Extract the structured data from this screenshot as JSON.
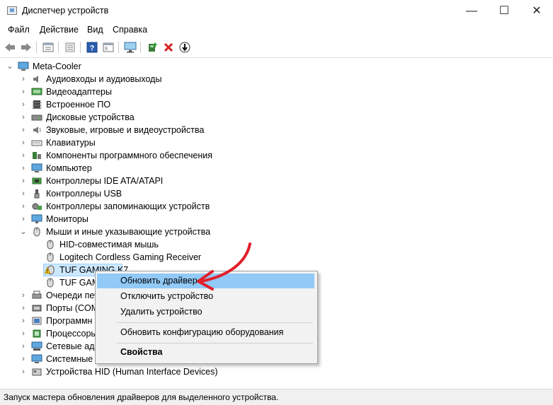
{
  "window": {
    "title": "Диспетчер устройств",
    "minimize": "—",
    "maximize": "☐",
    "close": "✕"
  },
  "menu": [
    "Файл",
    "Действие",
    "Вид",
    "Справка"
  ],
  "toolbar": {
    "icons": [
      "back-arrow-icon",
      "forward-arrow-icon",
      "properties-view-icon",
      "device-list-icon",
      "help-icon",
      "details-icon",
      "monitor-scan-icon",
      "update-driver-icon",
      "delete-icon",
      "download-icon"
    ]
  },
  "tree": {
    "root": "Meta-Cooler",
    "categories": [
      "Аудиовходы и аудиовыходы",
      "Видеоадаптеры",
      "Встроенное ПО",
      "Дисковые устройства",
      "Звуковые, игровые и видеоустройства",
      "Клавиатуры",
      "Компоненты программного обеспечения",
      "Компьютер",
      "Контроллеры IDE ATA/ATAPI",
      "Контроллеры USB",
      "Контроллеры запоминающих устройств",
      "Мониторы",
      "Мыши и иные указывающие устройства"
    ],
    "mice": [
      "HID-совместимая мышь",
      "Logitech Cordless Gaming Receiver",
      "TUF GAMING K7",
      "TUF GAM"
    ],
    "after": [
      "Очереди печ",
      "Порты (COM",
      "Программн",
      "Процессоры",
      "Сетевые ада",
      "Системные у",
      "Устройства HID (Human Interface Devices)"
    ]
  },
  "context_menu": {
    "items": [
      "Обновить драйвер",
      "Отключить устройство",
      "Удалить устройство",
      "Обновить конфигурацию оборудования",
      "Свойства"
    ],
    "highlighted_index": 0
  },
  "status": "Запуск мастера обновления драйверов для выделенного устройства.",
  "colors": {
    "highlight": "#91c9f7",
    "accent_arrow": "#e1202a",
    "delete_red": "#d32222"
  }
}
